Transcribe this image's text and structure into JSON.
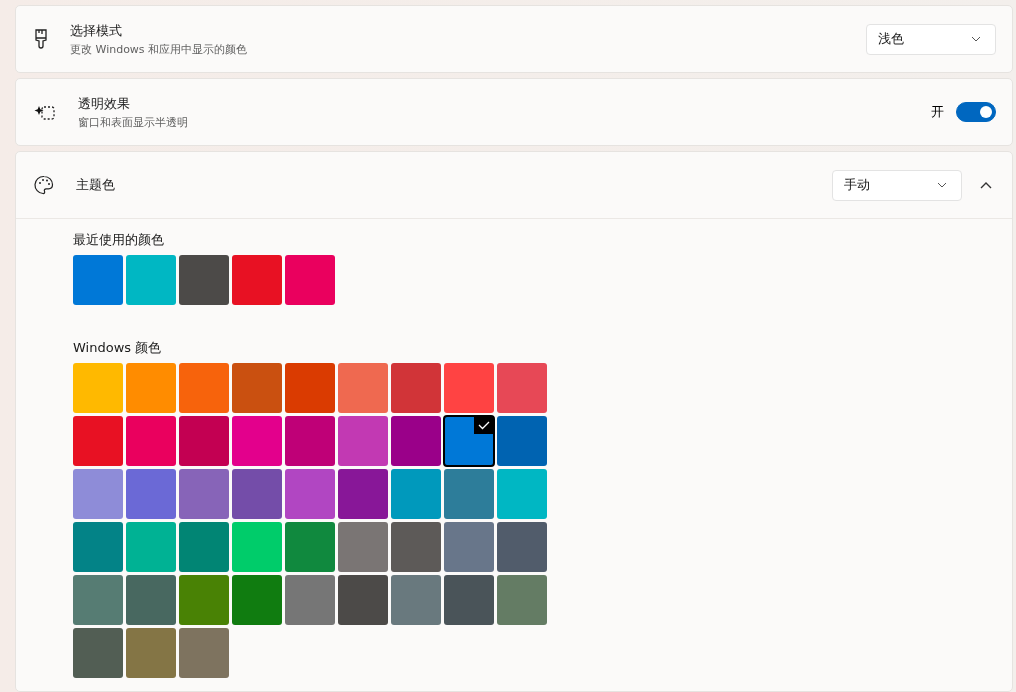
{
  "mode_card": {
    "title": "选择模式",
    "subtitle": "更改 Windows 和应用中显示的颜色",
    "dropdown": "浅色"
  },
  "transparency_card": {
    "title": "透明效果",
    "subtitle": "窗口和表面显示半透明",
    "state_label": "开",
    "on": true
  },
  "accent_card": {
    "title": "主题色",
    "dropdown": "手动",
    "expanded": true,
    "recent": {
      "label": "最近使用的颜色",
      "colors": [
        {
          "color": "#0078d7"
        },
        {
          "color": "#00b7c3"
        },
        {
          "color": "#4c4a48"
        },
        {
          "color": "#e81123"
        },
        {
          "color": "#ea005e"
        }
      ]
    },
    "windows": {
      "label": "Windows 颜色",
      "colors": [
        {
          "color": "#ffb900",
          "selected": false
        },
        {
          "color": "#ff8c00",
          "selected": false
        },
        {
          "color": "#f7630c",
          "selected": false
        },
        {
          "color": "#ca5010",
          "selected": false
        },
        {
          "color": "#da3b01",
          "selected": false
        },
        {
          "color": "#ef6950",
          "selected": false
        },
        {
          "color": "#d13438",
          "selected": false
        },
        {
          "color": "#ff4343",
          "selected": false
        },
        {
          "color": "#e74856",
          "selected": false
        },
        {
          "color": "#e81123",
          "selected": false
        },
        {
          "color": "#ea005e",
          "selected": false
        },
        {
          "color": "#c30052",
          "selected": false
        },
        {
          "color": "#e3008c",
          "selected": false
        },
        {
          "color": "#bf0077",
          "selected": false
        },
        {
          "color": "#c239b3",
          "selected": false
        },
        {
          "color": "#9a0089",
          "selected": false
        },
        {
          "color": "#0078d7",
          "selected": true
        },
        {
          "color": "#0063b1",
          "selected": false
        },
        {
          "color": "#8e8cd8",
          "selected": false
        },
        {
          "color": "#6b69d6",
          "selected": false
        },
        {
          "color": "#8764b8",
          "selected": false
        },
        {
          "color": "#744da9",
          "selected": false
        },
        {
          "color": "#b146c2",
          "selected": false
        },
        {
          "color": "#881798",
          "selected": false
        },
        {
          "color": "#0099bc",
          "selected": false
        },
        {
          "color": "#2d7d9a",
          "selected": false
        },
        {
          "color": "#00b7c3",
          "selected": false
        },
        {
          "color": "#038387",
          "selected": false
        },
        {
          "color": "#00b294",
          "selected": false
        },
        {
          "color": "#018574",
          "selected": false
        },
        {
          "color": "#00cc6a",
          "selected": false
        },
        {
          "color": "#10893e",
          "selected": false
        },
        {
          "color": "#7a7574",
          "selected": false
        },
        {
          "color": "#5d5a58",
          "selected": false
        },
        {
          "color": "#68768a",
          "selected": false
        },
        {
          "color": "#515c6b",
          "selected": false
        },
        {
          "color": "#567c73",
          "selected": false
        },
        {
          "color": "#486860",
          "selected": false
        },
        {
          "color": "#498205",
          "selected": false
        },
        {
          "color": "#107c10",
          "selected": false
        },
        {
          "color": "#767676",
          "selected": false
        },
        {
          "color": "#4c4a48",
          "selected": false
        },
        {
          "color": "#69797e",
          "selected": false
        },
        {
          "color": "#4a5459",
          "selected": false
        },
        {
          "color": "#647c64",
          "selected": false
        },
        {
          "color": "#525e54",
          "selected": false
        },
        {
          "color": "#847545",
          "selected": false
        },
        {
          "color": "#7e735f",
          "selected": false
        }
      ]
    }
  }
}
